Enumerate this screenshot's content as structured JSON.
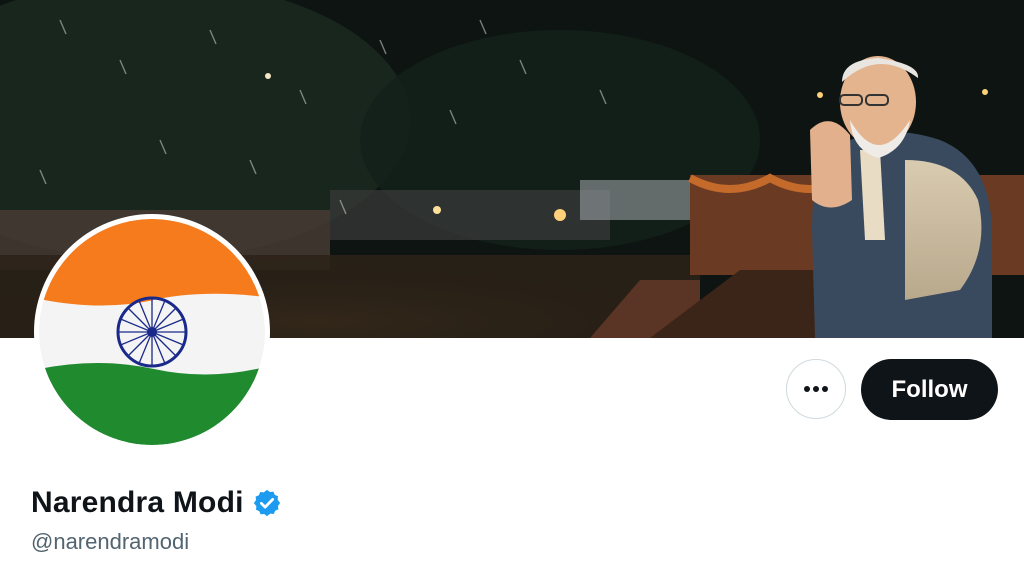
{
  "profile": {
    "display_name": "Narendra Modi",
    "handle": "@narendramodi",
    "verified": true,
    "verified_badge_color": "#1d9bf0"
  },
  "actions": {
    "more_icon": "more-horizontal-icon",
    "follow_label": "Follow"
  },
  "colors": {
    "follow_bg": "#0f1419",
    "handle_text": "#536471",
    "flag_saffron": "#f57b1c",
    "flag_white": "#f4f4f4",
    "flag_green": "#1f8a2e",
    "chakra_blue": "#1a2a8a"
  }
}
